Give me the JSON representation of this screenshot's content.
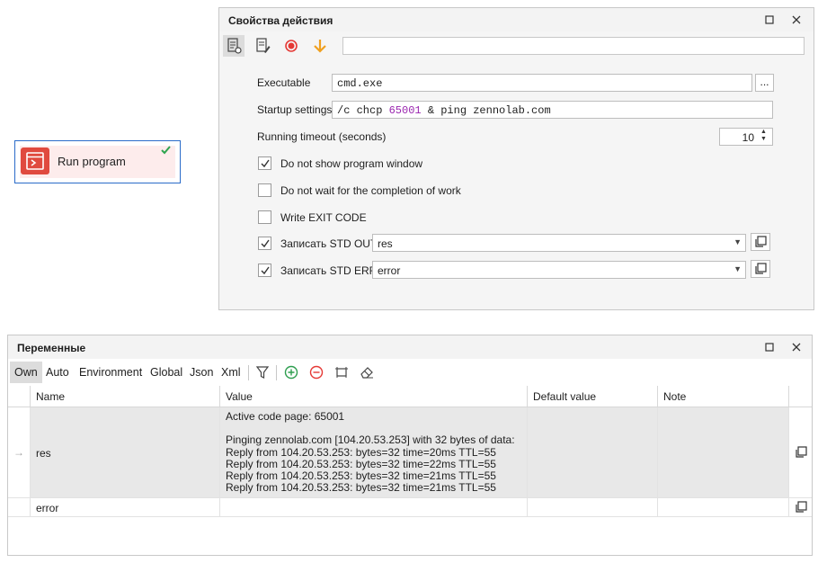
{
  "node": {
    "label": "Run program",
    "icon": "run-program-icon",
    "status_icon": "checkmark-icon",
    "accent": "#e04a3f",
    "border_color": "#2a6bc9"
  },
  "props": {
    "title": "Свойства действия",
    "toolbar_value": "",
    "executable_label": "Executable",
    "executable_value": "cmd.exe",
    "browse_label": "...",
    "startup_label": "Startup settings",
    "startup_prefix": "/c chcp ",
    "startup_number": "65001",
    "startup_suffix": " & ping zennolab.com",
    "timeout_label": "Running timeout (seconds)",
    "timeout_value": "10",
    "checkboxes": [
      {
        "label": "Do not show program window",
        "checked": true
      },
      {
        "label": "Do not wait for the completion of work",
        "checked": false
      },
      {
        "label": "Write EXIT CODE",
        "checked": false
      },
      {
        "label": "Записать STD OUT",
        "checked": true,
        "combo": "res"
      },
      {
        "label": "Записать STD ERR",
        "checked": true,
        "combo": "error"
      }
    ]
  },
  "vars": {
    "title": "Переменные",
    "tabs": [
      "Own",
      "Auto",
      "Environment",
      "Global",
      "Json",
      "Xml"
    ],
    "columns": [
      "Name",
      "Value",
      "Default value",
      "Note"
    ],
    "rows": [
      {
        "name": "res",
        "value": "Active code page: 65001\n\nPinging zennolab.com [104.20.53.253] with 32 bytes of data:\nReply from 104.20.53.253: bytes=32 time=20ms TTL=55\nReply from 104.20.53.253: bytes=32 time=22ms TTL=55\nReply from 104.20.53.253: bytes=32 time=21ms TTL=55\nReply from 104.20.53.253: bytes=32 time=21ms TTL=55",
        "default": "",
        "note": ""
      },
      {
        "name": "error",
        "value": "",
        "default": "",
        "note": ""
      }
    ],
    "row_marker": "→"
  }
}
